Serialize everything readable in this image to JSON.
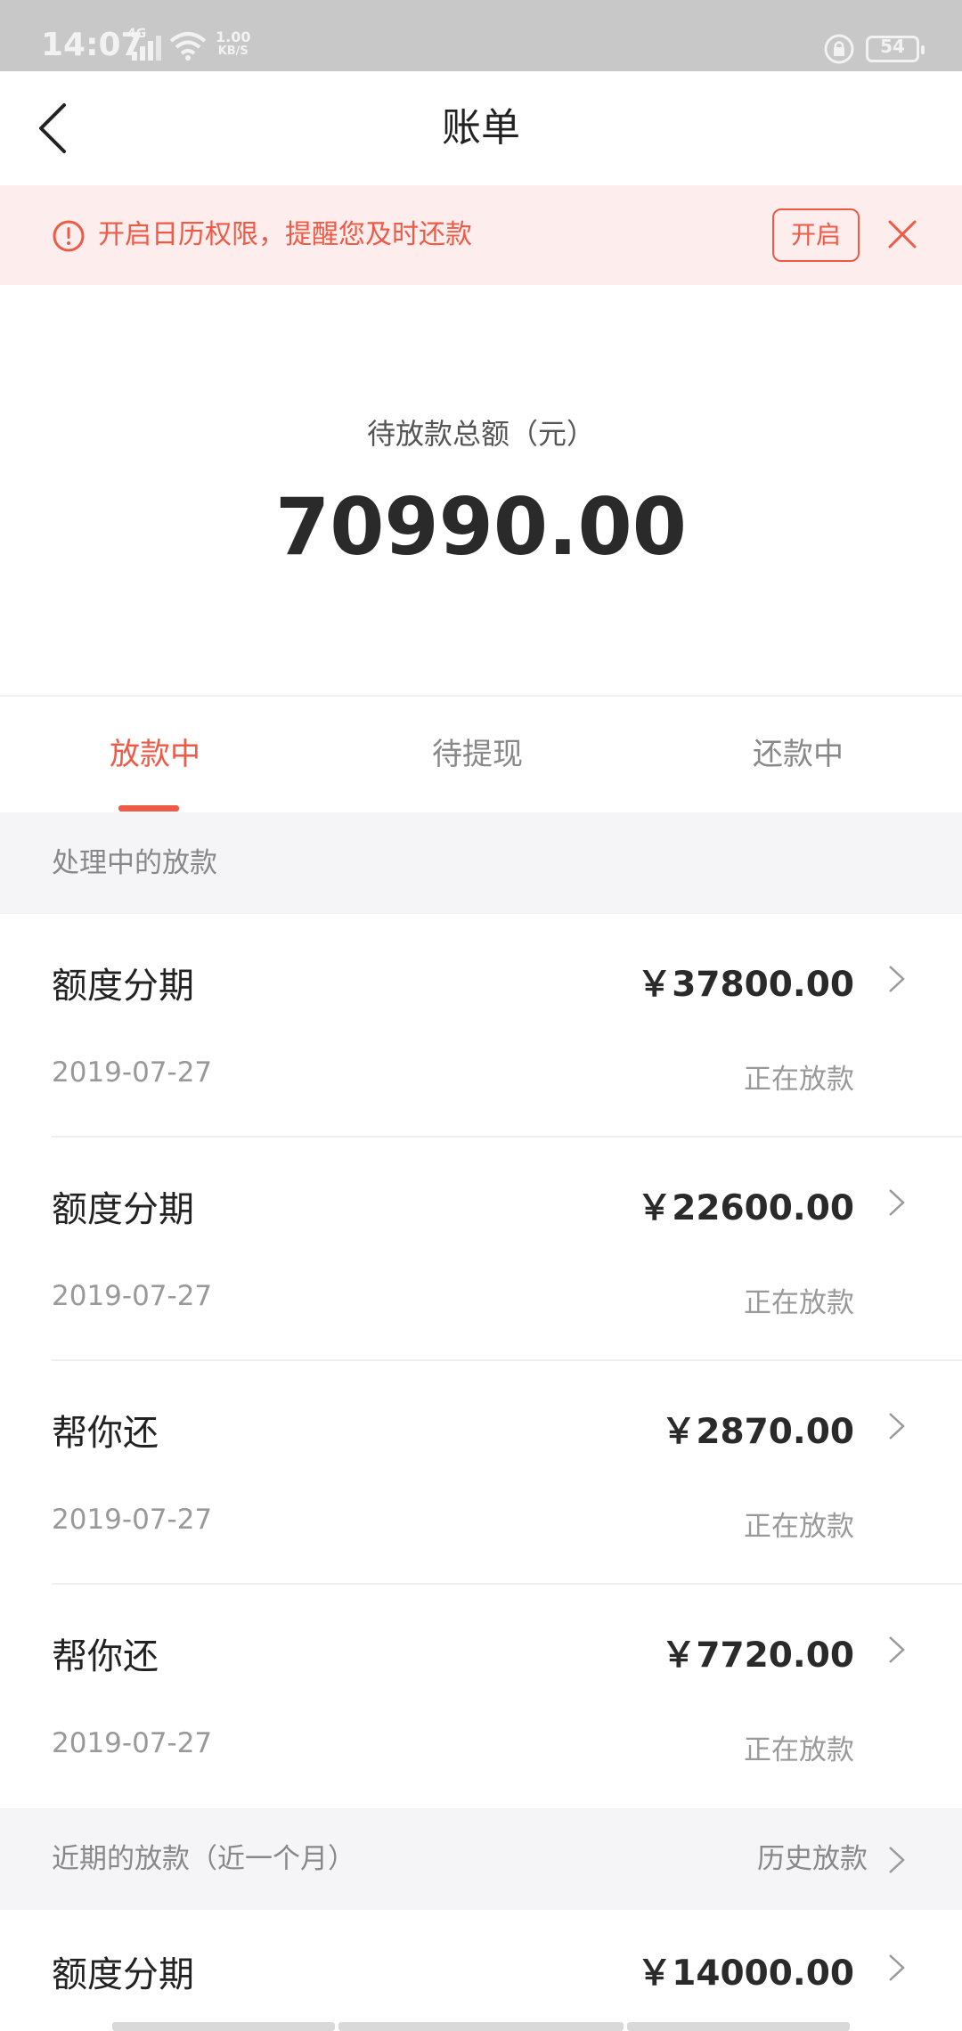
{
  "status_bar": {
    "time": "14:07",
    "network": "4G",
    "speed_value": "1.00",
    "speed_unit": "KB/S",
    "battery": "54"
  },
  "header": {
    "title": "账单",
    "back_icon": "chevron-left-icon"
  },
  "notice": {
    "text": "开启日历权限，提醒您及时还款",
    "open_label": "开启",
    "accent": "#ee5a46",
    "background": "#fdeeed"
  },
  "summary": {
    "label": "待放款总额（元）",
    "amount": "70990.00"
  },
  "tabs": [
    {
      "label": "放款中",
      "active": true
    },
    {
      "label": "待提现",
      "active": false
    },
    {
      "label": "还款中",
      "active": false
    }
  ],
  "processing_section": {
    "title": "处理中的放款",
    "items": [
      {
        "name": "额度分期",
        "amount": "￥37800.00",
        "date": "2019-07-27",
        "status": "正在放款"
      },
      {
        "name": "额度分期",
        "amount": "￥22600.00",
        "date": "2019-07-27",
        "status": "正在放款"
      },
      {
        "name": "帮你还",
        "amount": "￥2870.00",
        "date": "2019-07-27",
        "status": "正在放款"
      },
      {
        "name": "帮你还",
        "amount": "￥7720.00",
        "date": "2019-07-27",
        "status": "正在放款"
      }
    ]
  },
  "recent_section": {
    "title": "近期的放款（近一个月）",
    "history_label": "历史放款",
    "items": [
      {
        "name": "额度分期",
        "amount": "￥14000.00"
      }
    ]
  }
}
